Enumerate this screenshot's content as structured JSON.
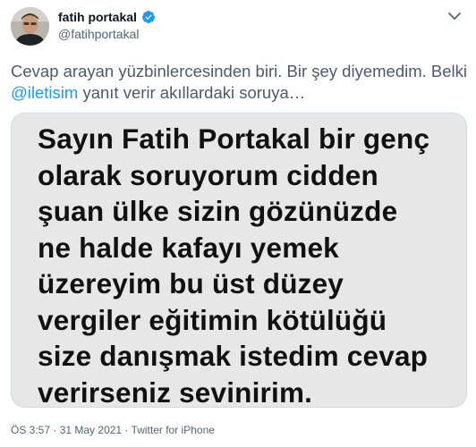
{
  "author": {
    "display_name": "fatih portakal",
    "handle": "@fatihportakal",
    "verified": true
  },
  "tweet": {
    "text_part1": "Cevap arayan yüzbinlercesinden biri. Bir şey diyemedim. Belki ",
    "mention": "@iletisim",
    "text_part2": " yanıt verir akıllardaki soruya…"
  },
  "media": {
    "lines": [
      "Sayın Fatih Portakal bir genç",
      "olarak soruyorum cidden",
      "şuan ülke sizin gözünüzde",
      "ne halde kafayı yemek",
      "üzereyim bu üst düzey",
      "vergiler eğitimin kötülüğü",
      "size danışmak istedim cevap",
      "verirseniz sevinirim."
    ]
  },
  "meta": {
    "time": "ÖS 3:57",
    "separator1": " · ",
    "date": "31 May 2021",
    "separator2": " · ",
    "source": "Twitter for iPhone"
  },
  "colors": {
    "accent": "#1d9bf0",
    "secondary_text": "#536471",
    "media_background": "#e7e7e8"
  },
  "icons": {
    "verified": "verified-badge-icon",
    "more": "chevron-down-icon"
  }
}
